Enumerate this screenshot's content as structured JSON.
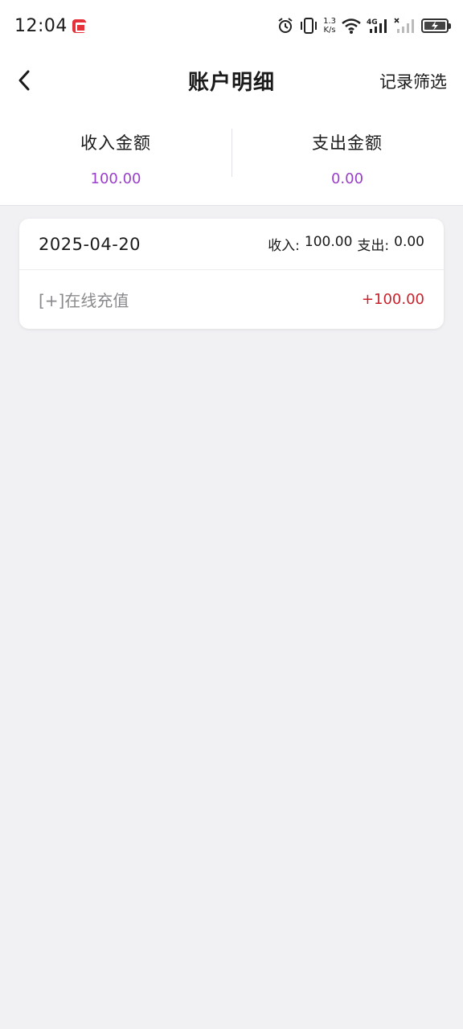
{
  "status_bar": {
    "time": "12:04",
    "net_speed_value": "1.3",
    "net_speed_unit": "K/s",
    "icons": [
      "notification-icon",
      "alarm-icon",
      "vibrate-icon",
      "wifi-icon",
      "signal-4g-icon",
      "signal-icon",
      "battery-icon"
    ]
  },
  "header": {
    "title": "账户明细",
    "filter_label": "记录筛选",
    "back_icon": "chevron-left-icon"
  },
  "summary": {
    "income_label": "收入金额",
    "income_value": "100.00",
    "expense_label": "支出金额",
    "expense_value": "0.00"
  },
  "records": [
    {
      "date": "2025-04-20",
      "income_label": "收入:",
      "income_value": "100.00",
      "expense_label": "支出:",
      "expense_value": "0.00",
      "items": [
        {
          "desc": "[+]在线充值",
          "amount": "+100.00"
        }
      ]
    }
  ],
  "colors": {
    "accent_purple": "#9a3fc9",
    "amount_red": "#c8232c",
    "background": "#f1f1f4"
  }
}
